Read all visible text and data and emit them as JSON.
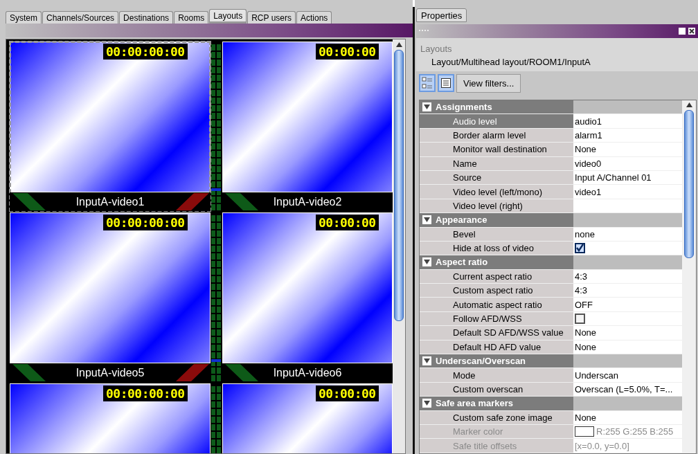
{
  "tabs": [
    {
      "label": "System",
      "selected": false
    },
    {
      "label": "Channels/Sources",
      "selected": false
    },
    {
      "label": "Destinations",
      "selected": false
    },
    {
      "label": "Rooms",
      "selected": false
    },
    {
      "label": "Layouts",
      "selected": true
    },
    {
      "label": "RCP users",
      "selected": false
    },
    {
      "label": "Actions",
      "selected": false
    }
  ],
  "monitor_rows": [
    {
      "tiles": [
        {
          "timecode": "00:00:00:00",
          "caption": "InputA-video1",
          "selected": true,
          "alarm": true
        },
        {
          "timecode": "00:00:00",
          "caption": "InputA-video2",
          "selected": false,
          "alarm": false
        }
      ]
    },
    {
      "tiles": [
        {
          "timecode": "00:00:00:00",
          "caption": "InputA-video5",
          "selected": false,
          "alarm": true
        },
        {
          "timecode": "00:00:00",
          "caption": "InputA-video6",
          "selected": false,
          "alarm": false
        }
      ]
    },
    {
      "tiles": [
        {
          "timecode": "00:00:00:00",
          "selected": false
        },
        {
          "timecode": "00:00:00",
          "selected": false
        }
      ]
    }
  ],
  "properties": {
    "tab": "Properties",
    "heading": "Layouts",
    "path": "Layout/Multihead layout/ROOM1/InputA",
    "filter_button": "View filters...",
    "sections": [
      {
        "title": "Assignments",
        "expanded": true,
        "rows": [
          {
            "label": "Audio level",
            "kind": "text",
            "value": "audio1",
            "selected": true,
            "disabled": false
          },
          {
            "label": "Border alarm level",
            "kind": "text",
            "value": "alarm1",
            "selected": false,
            "disabled": false
          },
          {
            "label": "Monitor wall destination",
            "kind": "text",
            "value": "None",
            "selected": false,
            "disabled": false
          },
          {
            "label": "Name",
            "kind": "text",
            "value": "video0",
            "selected": false,
            "disabled": false
          },
          {
            "label": "Source",
            "kind": "text",
            "value": "Input A/Channel 01",
            "selected": false,
            "disabled": false
          },
          {
            "label": "Video level (left/mono)",
            "kind": "text",
            "value": "video1",
            "selected": false,
            "disabled": false
          },
          {
            "label": "Video level (right)",
            "kind": "text",
            "selected": false,
            "disabled": false
          }
        ]
      },
      {
        "title": "Appearance",
        "expanded": true,
        "rows": [
          {
            "label": "Bevel",
            "kind": "text",
            "value": "none",
            "selected": false,
            "disabled": false
          },
          {
            "label": "Hide at loss of video",
            "kind": "checkbox",
            "checked": true,
            "selected": false,
            "disabled": false
          }
        ]
      },
      {
        "title": "Aspect ratio",
        "expanded": true,
        "rows": [
          {
            "label": "Current aspect ratio",
            "kind": "text",
            "value": "4:3",
            "selected": false,
            "disabled": false
          },
          {
            "label": "Custom aspect ratio",
            "kind": "text",
            "value": "4:3",
            "selected": false,
            "disabled": false
          },
          {
            "label": "Automatic aspect ratio",
            "kind": "text",
            "value": "OFF",
            "selected": false,
            "disabled": false
          },
          {
            "label": "Follow AFD/WSS",
            "kind": "checkbox",
            "checked": false,
            "selected": false,
            "disabled": false
          },
          {
            "label": "Default SD AFD/WSS value",
            "kind": "text",
            "value": "None",
            "selected": false,
            "disabled": false
          },
          {
            "label": "Default HD AFD value",
            "kind": "text",
            "value": "None",
            "selected": false,
            "disabled": false
          }
        ]
      },
      {
        "title": "Underscan/Overscan",
        "expanded": true,
        "rows": [
          {
            "label": "Mode",
            "kind": "text",
            "value": "Underscan",
            "selected": false,
            "disabled": false
          },
          {
            "label": "Custom overscan",
            "kind": "text",
            "value": "Overscan (L=5.0%, T=...",
            "selected": false,
            "disabled": false
          }
        ]
      },
      {
        "title": "Safe area markers",
        "expanded": true,
        "rows": [
          {
            "label": "Custom safe zone image",
            "kind": "text",
            "value": "None",
            "selected": false,
            "disabled": false
          },
          {
            "label": "Marker color",
            "kind": "color",
            "color": "#ffffff",
            "value": "R:255 G:255 B:255",
            "selected": false,
            "disabled": true
          },
          {
            "label": "Safe title offsets",
            "kind": "text",
            "value": "[x=0.0, y=0.0]",
            "selected": false,
            "disabled": true
          }
        ]
      }
    ]
  }
}
